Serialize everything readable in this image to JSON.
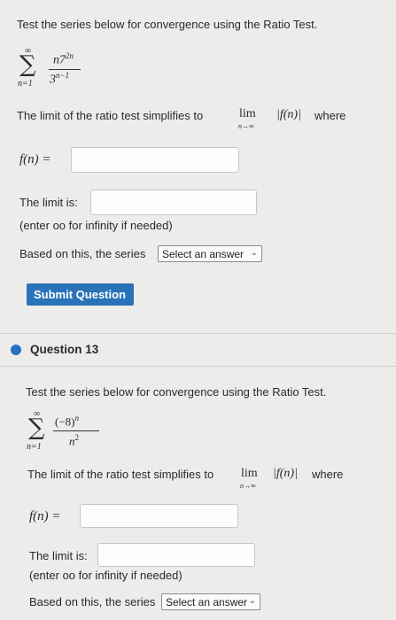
{
  "q12": {
    "instruction": "Test the series below for convergence using the Ratio Test.",
    "series_upper": "∞",
    "series_lower": "n=1",
    "numerator_base": "n7",
    "numerator_exp": "2n",
    "denominator_base": "3",
    "denominator_exp": "n−1",
    "limit_text": "The limit of the ratio test simplifies to",
    "lim_word": "lim",
    "lim_sub": "n→∞",
    "abs_expr": "|f(n)|",
    "where_text": "where",
    "fn_label": "f(n) =",
    "fn_value": "",
    "limit_label": "The limit is:",
    "limit_value": "",
    "infinity_hint": "(enter oo for infinity if needed)",
    "based_text": "Based on this, the series",
    "select_value": "Select an answer",
    "submit_label": "Submit Question"
  },
  "q13": {
    "title": "Question 13",
    "instruction": "Test the series below for convergence using the Ratio Test.",
    "series_upper": "∞",
    "series_lower": "n=1",
    "numerator_base": "(−8)",
    "numerator_exp": "n",
    "denominator_base": "n",
    "denominator_exp": "2",
    "limit_text": "The limit of the ratio test simplifies to",
    "lim_word": "lim",
    "lim_sub": "n→∞",
    "abs_expr": "|f(n)|",
    "where_text": "where",
    "fn_label": "f(n) =",
    "fn_value": "",
    "limit_label": "The limit is:",
    "limit_value": "",
    "infinity_hint": "(enter oo for infinity if needed)",
    "based_text": "Based on this, the series",
    "select_value": "Select an answer"
  },
  "colors": {
    "page_bg": "#eeecea",
    "accent": "#2a73b8",
    "bullet": "#2a6fc0"
  }
}
